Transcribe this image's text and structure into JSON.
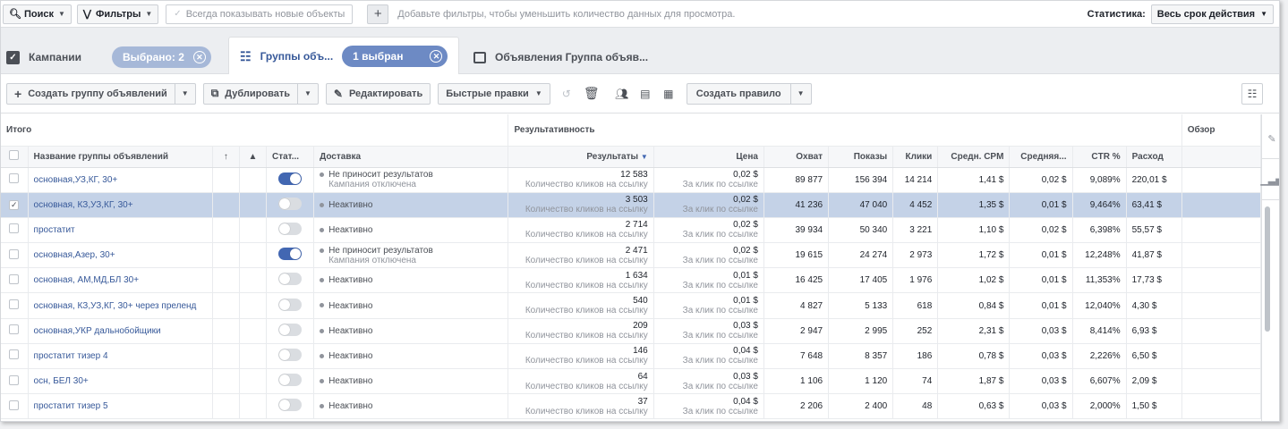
{
  "topbar": {
    "search_label": "Поиск",
    "filters_label": "Фильтры",
    "always_show_label": "Всегда показывать новые объекты",
    "add_filter_hint": "Добавьте фильтры, чтобы уменьшить количество данных для просмотра.",
    "stats_label": "Статистика:",
    "period_label": "Весь срок действия"
  },
  "tabs": {
    "campaigns_label": "Кампании",
    "campaigns_selected": "Выбрано: 2",
    "adsets_label": "Группы объ...",
    "adsets_selected": "1 выбран",
    "ads_label": "Объявления Группа объяв..."
  },
  "toolbar": {
    "create_label": "Создать группу объявлений",
    "duplicate_label": "Дублировать",
    "edit_label": "Редактировать",
    "quick_edit_label": "Быстрые правки",
    "create_rule_label": "Создать правило"
  },
  "table": {
    "group_total": "Итого",
    "group_performance": "Результативность",
    "group_overview": "Обзор",
    "headers": {
      "name": "Название группы объявлений",
      "status": "Стат...",
      "delivery": "Доставка",
      "results": "Результаты",
      "price": "Цена",
      "reach": "Охват",
      "impressions": "Показы",
      "clicks": "Клики",
      "cpm": "Средн. CPM",
      "avg": "Средняя...",
      "ctr": "CTR %",
      "spend": "Расход"
    },
    "rows": [
      {
        "name": "основная,УЗ,КГ, 30+",
        "active": true,
        "delivery": "Не приносит результатов",
        "delivery_sub": "Кампания отключена",
        "results": "12 583",
        "results_sub": "Количество кликов на ссылку",
        "price": "0,02 $",
        "price_sub": "За клик по ссылке",
        "reach": "89 877",
        "impressions": "156 394",
        "clicks": "14 214",
        "cpm": "1,41 $",
        "avg": "0,02 $",
        "ctr": "9,089%",
        "spend": "220,01 $"
      },
      {
        "name": "основная, КЗ,УЗ,КГ, 30+",
        "active": false,
        "selected": true,
        "delivery": "Неактивно",
        "delivery_sub": "",
        "results": "3 503",
        "results_sub": "Количество кликов на ссылку",
        "price": "0,02 $",
        "price_sub": "За клик по ссылке",
        "reach": "41 236",
        "impressions": "47 040",
        "clicks": "4 452",
        "cpm": "1,35 $",
        "avg": "0,01 $",
        "ctr": "9,464%",
        "spend": "63,41 $"
      },
      {
        "name": "простатит",
        "active": false,
        "delivery": "Неактивно",
        "delivery_sub": "",
        "results": "2 714",
        "results_sub": "Количество кликов на ссылку",
        "price": "0,02 $",
        "price_sub": "За клик по ссылке",
        "reach": "39 934",
        "impressions": "50 340",
        "clicks": "3 221",
        "cpm": "1,10 $",
        "avg": "0,02 $",
        "ctr": "6,398%",
        "spend": "55,57 $"
      },
      {
        "name": "основная,Азер, 30+",
        "active": true,
        "delivery": "Не приносит результатов",
        "delivery_sub": "Кампания отключена",
        "results": "2 471",
        "results_sub": "Количество кликов на ссылку",
        "price": "0,02 $",
        "price_sub": "За клик по ссылке",
        "reach": "19 615",
        "impressions": "24 274",
        "clicks": "2 973",
        "cpm": "1,72 $",
        "avg": "0,01 $",
        "ctr": "12,248%",
        "spend": "41,87 $"
      },
      {
        "name": "основная, АМ,МД,БЛ 30+",
        "active": false,
        "delivery": "Неактивно",
        "delivery_sub": "",
        "results": "1 634",
        "results_sub": "Количество кликов на ссылку",
        "price": "0,01 $",
        "price_sub": "За клик по ссылке",
        "reach": "16 425",
        "impressions": "17 405",
        "clicks": "1 976",
        "cpm": "1,02 $",
        "avg": "0,01 $",
        "ctr": "11,353%",
        "spend": "17,73 $"
      },
      {
        "name": "основная, КЗ,УЗ,КГ, 30+ через преленд",
        "active": false,
        "delivery": "Неактивно",
        "delivery_sub": "",
        "results": "540",
        "results_sub": "Количество кликов на ссылку",
        "price": "0,01 $",
        "price_sub": "За клик по ссылке",
        "reach": "4 827",
        "impressions": "5 133",
        "clicks": "618",
        "cpm": "0,84 $",
        "avg": "0,01 $",
        "ctr": "12,040%",
        "spend": "4,30 $"
      },
      {
        "name": "основная,УКР дальнобойщики",
        "active": false,
        "delivery": "Неактивно",
        "delivery_sub": "",
        "results": "209",
        "results_sub": "Количество кликов на ссылку",
        "price": "0,03 $",
        "price_sub": "За клик по ссылке",
        "reach": "2 947",
        "impressions": "2 995",
        "clicks": "252",
        "cpm": "2,31 $",
        "avg": "0,03 $",
        "ctr": "8,414%",
        "spend": "6,93 $"
      },
      {
        "name": "простатит тизер 4",
        "active": false,
        "delivery": "Неактивно",
        "delivery_sub": "",
        "results": "146",
        "results_sub": "Количество кликов на ссылку",
        "price": "0,04 $",
        "price_sub": "За клик по ссылке",
        "reach": "7 648",
        "impressions": "8 357",
        "clicks": "186",
        "cpm": "0,78 $",
        "avg": "0,03 $",
        "ctr": "2,226%",
        "spend": "6,50 $"
      },
      {
        "name": "осн, БЕЛ 30+",
        "active": false,
        "delivery": "Неактивно",
        "delivery_sub": "",
        "results": "64",
        "results_sub": "Количество кликов на ссылку",
        "price": "0,03 $",
        "price_sub": "За клик по ссылке",
        "reach": "1 106",
        "impressions": "1 120",
        "clicks": "74",
        "cpm": "1,87 $",
        "avg": "0,03 $",
        "ctr": "6,607%",
        "spend": "2,09 $"
      },
      {
        "name": "простатит тизер 5",
        "active": false,
        "delivery": "Неактивно",
        "delivery_sub": "",
        "results": "37",
        "results_sub": "Количество кликов на ссылку",
        "price": "0,04 $",
        "price_sub": "За клик по ссылке",
        "reach": "2 206",
        "impressions": "2 400",
        "clicks": "48",
        "cpm": "0,63 $",
        "avg": "0,03 $",
        "ctr": "2,000%",
        "spend": "1,50 $"
      }
    ]
  }
}
